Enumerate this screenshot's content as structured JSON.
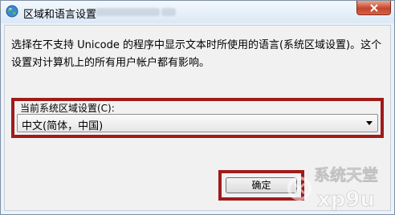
{
  "window": {
    "title": "区域和语言设置"
  },
  "dialog": {
    "description": "选择在不支持 Unicode 的程序中显示文本时所使用的语言(系统区域设置)。这个设置对计算机上的所有用户帐户都有影响。",
    "select_label": "当前系统区域设置(C):",
    "select_value": "中文(简体，中国)",
    "ok_label": "确定"
  },
  "watermark": {
    "line1": "系统天堂",
    "line2": "xp9u"
  },
  "colors": {
    "highlight": "#a01b1b",
    "close_button": "#c6452c",
    "title_bg": "#dce8f6"
  },
  "icons": {
    "title_icon": "globe-icon",
    "close_icon": "close-icon",
    "dropdown_icon": "chevron-down-icon"
  }
}
